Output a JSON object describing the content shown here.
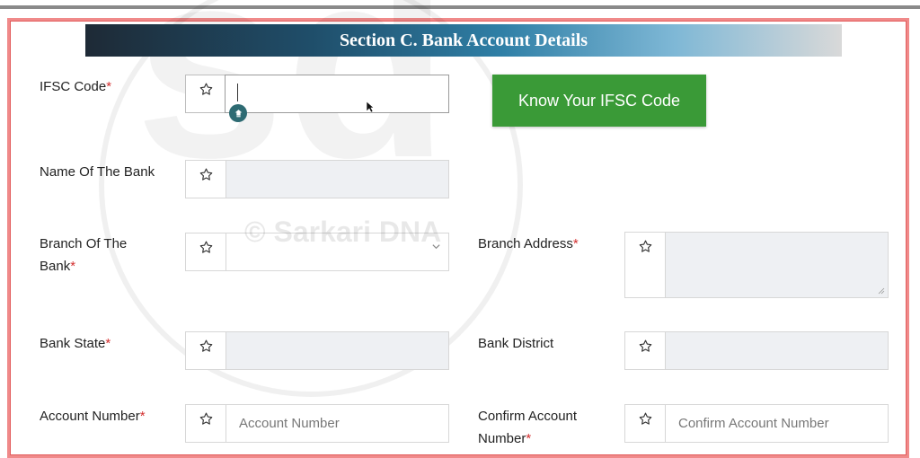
{
  "section_title": "Section C. Bank Account Details",
  "ifsc": {
    "label": "IFSC Code",
    "required": "*",
    "value": ""
  },
  "know_ifsc_button": "Know Your IFSC Code",
  "bank_name": {
    "label": "Name Of The Bank",
    "value": ""
  },
  "branch": {
    "label_line1": "Branch Of The",
    "label_line2": "Bank",
    "required": "*",
    "value": ""
  },
  "branch_address": {
    "label": "Branch Address",
    "required": "*",
    "value": ""
  },
  "bank_state": {
    "label": "Bank State",
    "required": "*",
    "value": ""
  },
  "bank_district": {
    "label": "Bank District",
    "value": ""
  },
  "account_number": {
    "label": "Account Number",
    "required": "*",
    "placeholder": "Account Number"
  },
  "confirm_account": {
    "label_line1": "Confirm Account",
    "label_line2": "Number",
    "required": "*",
    "placeholder": "Confirm Account Number"
  },
  "watermark": {
    "letters": "sd",
    "text": "© Sarkari DNA"
  },
  "icons": {
    "field_icon": "star-outline-icon",
    "badge_icon": "keyboard-badge-icon"
  },
  "colors": {
    "button": "#3a9a37",
    "required": "#d32f2f",
    "frame": "#f08a8a"
  }
}
